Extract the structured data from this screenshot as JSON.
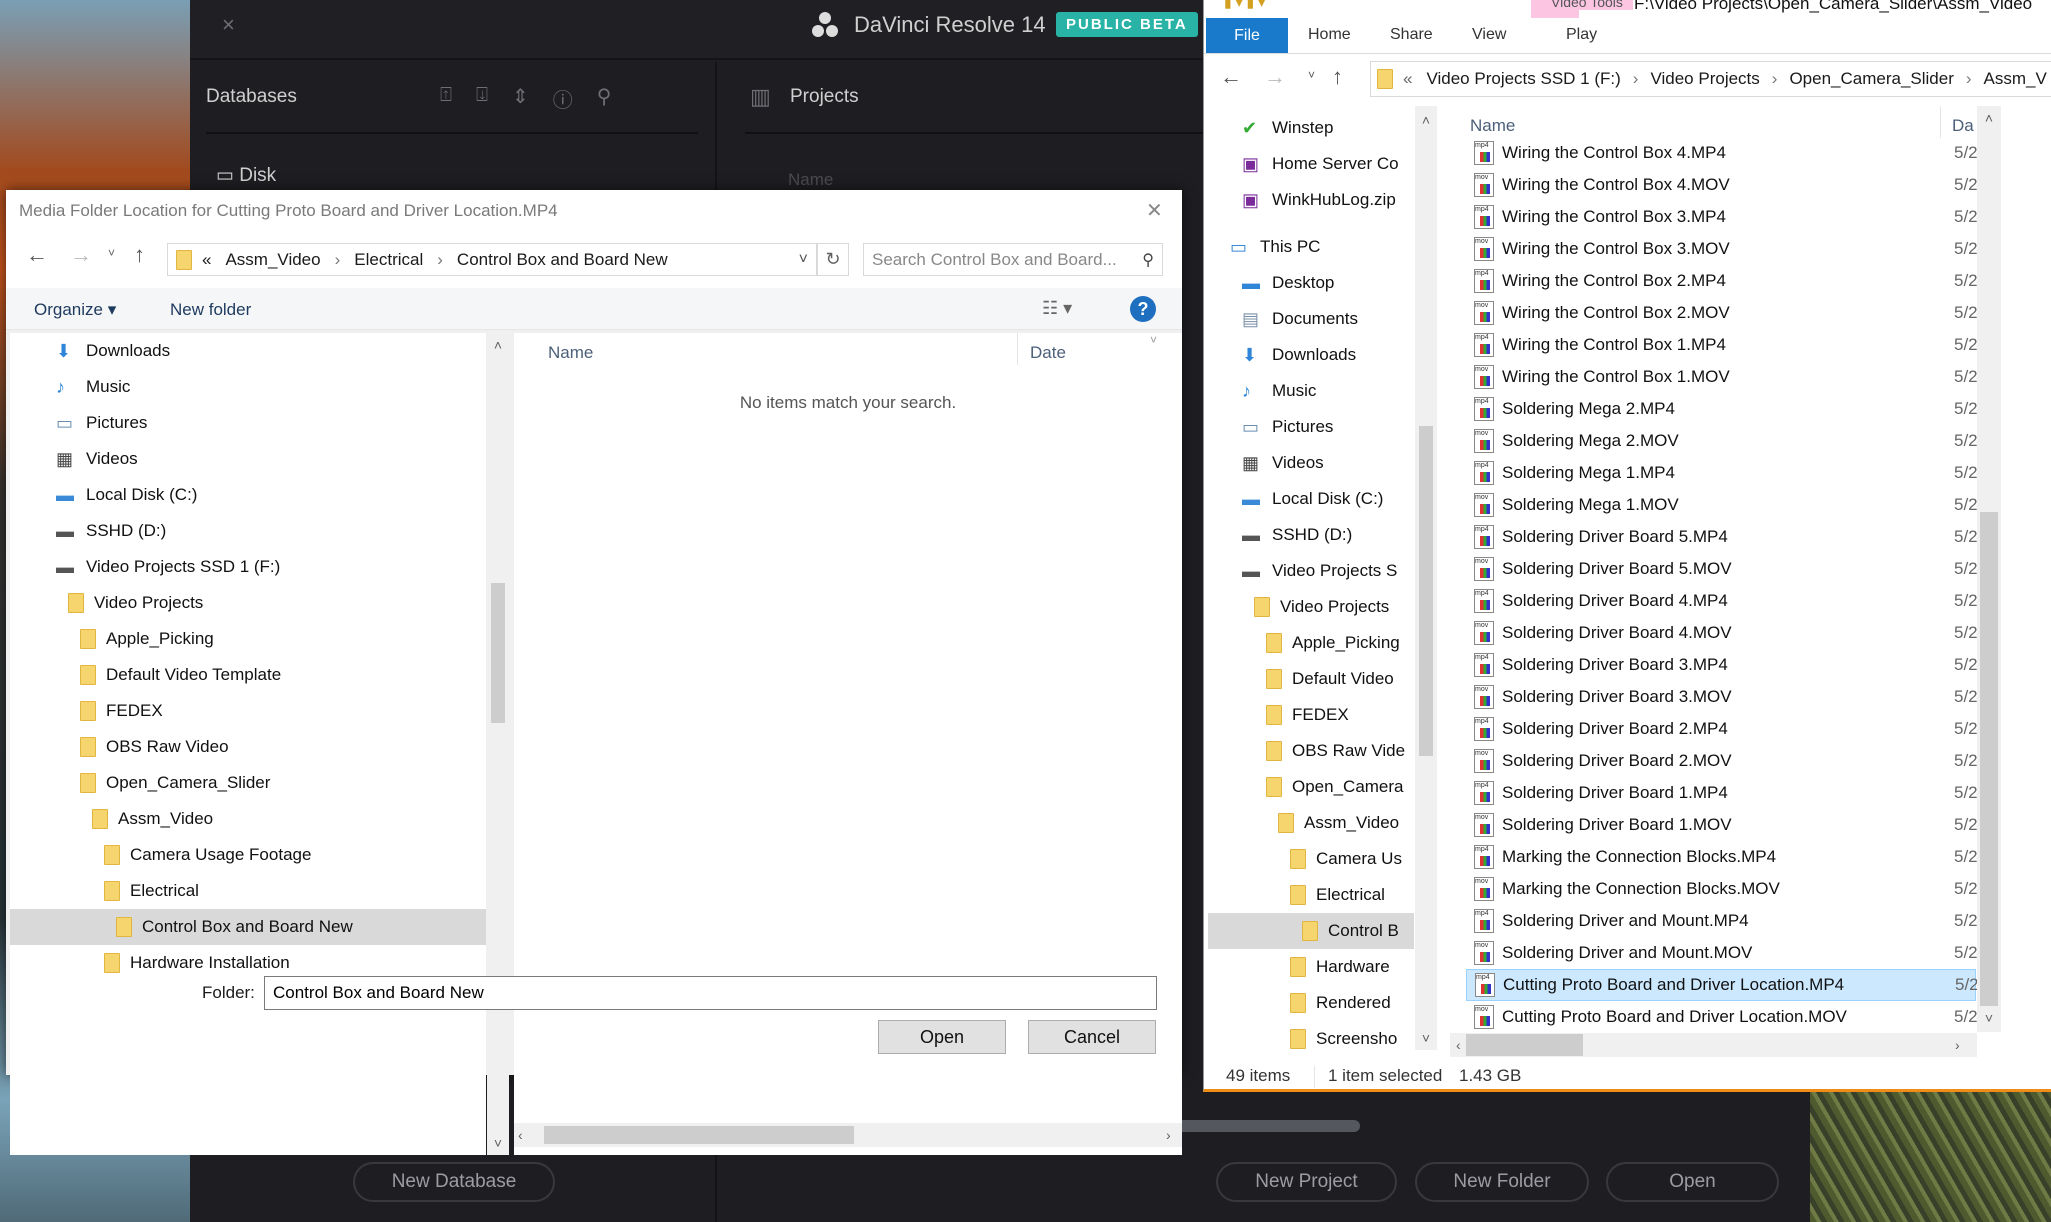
{
  "resolve": {
    "close": "×",
    "app_title": "DaVinci Resolve 14",
    "badge": "PUBLIC BETA",
    "databases_label": "Databases",
    "disk_label": "Disk",
    "projects_label": "Projects",
    "name_col": "Name",
    "new_database": "New Database",
    "new_project": "New Project",
    "new_folder": "New Folder",
    "open": "Open"
  },
  "dialog": {
    "title": "Media Folder Location for Cutting Proto Board and Driver Location.MP4",
    "close": "✕",
    "breadcrumb": [
      "«",
      "Assm_Video",
      "Electrical",
      "Control Box and Board New"
    ],
    "search_placeholder": "Search Control Box and Board...",
    "organize": "Organize ▾",
    "new_folder": "New folder",
    "col_name": "Name",
    "col_date": "Date",
    "empty_message": "No items match your search.",
    "folder_label": "Folder:",
    "folder_value": "Control Box and Board New",
    "open": "Open",
    "cancel": "Cancel",
    "nav": [
      {
        "label": "Downloads",
        "level": 0,
        "icon": "download"
      },
      {
        "label": "Music",
        "level": 0,
        "icon": "music"
      },
      {
        "label": "Pictures",
        "level": 0,
        "icon": "pictures"
      },
      {
        "label": "Videos",
        "level": 0,
        "icon": "videos"
      },
      {
        "label": "Local Disk (C:)",
        "level": 0,
        "icon": "disk"
      },
      {
        "label": "SSHD (D:)",
        "level": 0,
        "icon": "drive"
      },
      {
        "label": "Video Projects SSD 1 (F:)",
        "level": 0,
        "icon": "drive"
      },
      {
        "label": "Video Projects",
        "level": 1,
        "icon": "folder"
      },
      {
        "label": "Apple_Picking",
        "level": 2,
        "icon": "folder"
      },
      {
        "label": "Default Video Template",
        "level": 2,
        "icon": "folder"
      },
      {
        "label": "FEDEX",
        "level": 2,
        "icon": "folder"
      },
      {
        "label": "OBS Raw Video",
        "level": 2,
        "icon": "folder"
      },
      {
        "label": "Open_Camera_Slider",
        "level": 2,
        "icon": "folder"
      },
      {
        "label": "Assm_Video",
        "level": 3,
        "icon": "folder"
      },
      {
        "label": "Camera Usage Footage",
        "level": 4,
        "icon": "folder"
      },
      {
        "label": "Electrical",
        "level": 4,
        "icon": "folder"
      },
      {
        "label": "Control Box and Board New",
        "level": 5,
        "icon": "folder",
        "selected": true
      },
      {
        "label": "Hardware Installation",
        "level": 4,
        "icon": "folder"
      }
    ]
  },
  "explorer": {
    "title_path": "F:\\Video Projects\\Open_Camera_Slider\\Assm_Video",
    "context_tab": "Video Tools",
    "tabs": [
      "File",
      "Home",
      "Share",
      "View",
      "Play"
    ],
    "breadcrumb": [
      "«",
      "Video Projects SSD 1 (F:)",
      "Video Projects",
      "Open_Camera_Slider",
      "Assm_V"
    ],
    "col_name": "Name",
    "col_date": "Da",
    "nav": [
      {
        "label": "Winstep",
        "level": 1,
        "icon": "folder-check"
      },
      {
        "label": "Home Server Co",
        "level": 1,
        "icon": "zip"
      },
      {
        "label": "WinkHubLog.zip",
        "level": 1,
        "icon": "zip"
      },
      {
        "label": "This PC",
        "level": 0,
        "icon": "pc",
        "gap": true
      },
      {
        "label": "Desktop",
        "level": 1,
        "icon": "desktop"
      },
      {
        "label": "Documents",
        "level": 1,
        "icon": "documents"
      },
      {
        "label": "Downloads",
        "level": 1,
        "icon": "download"
      },
      {
        "label": "Music",
        "level": 1,
        "icon": "music"
      },
      {
        "label": "Pictures",
        "level": 1,
        "icon": "pictures"
      },
      {
        "label": "Videos",
        "level": 1,
        "icon": "videos"
      },
      {
        "label": "Local Disk (C:)",
        "level": 1,
        "icon": "disk"
      },
      {
        "label": "SSHD (D:)",
        "level": 1,
        "icon": "drive"
      },
      {
        "label": "Video Projects S",
        "level": 1,
        "icon": "drive"
      },
      {
        "label": "Video Projects",
        "level": 2,
        "icon": "folder"
      },
      {
        "label": "Apple_Picking",
        "level": 3,
        "icon": "folder"
      },
      {
        "label": "Default Video",
        "level": 3,
        "icon": "folder"
      },
      {
        "label": "FEDEX",
        "level": 3,
        "icon": "folder"
      },
      {
        "label": "OBS Raw Vide",
        "level": 3,
        "icon": "folder"
      },
      {
        "label": "Open_Camera",
        "level": 3,
        "icon": "folder"
      },
      {
        "label": "Assm_Video",
        "level": 4,
        "icon": "folder"
      },
      {
        "label": "Camera Us",
        "level": 5,
        "icon": "folder"
      },
      {
        "label": "Electrical",
        "level": 5,
        "icon": "folder"
      },
      {
        "label": "Control B",
        "level": 6,
        "icon": "folder",
        "selected": true
      },
      {
        "label": "Hardware",
        "level": 5,
        "icon": "folder"
      },
      {
        "label": "Rendered",
        "level": 5,
        "icon": "folder"
      },
      {
        "label": "Screensho",
        "level": 5,
        "icon": "folder"
      }
    ],
    "files": [
      {
        "name": "Wiring the Control Box 4.MP4",
        "type": "mp4",
        "date": "5/2"
      },
      {
        "name": "Wiring the Control Box 4.MOV",
        "type": "mov",
        "date": "5/2"
      },
      {
        "name": "Wiring the Control Box 3.MP4",
        "type": "mp4",
        "date": "5/2"
      },
      {
        "name": "Wiring the Control Box 3.MOV",
        "type": "mov",
        "date": "5/2"
      },
      {
        "name": "Wiring the Control Box 2.MP4",
        "type": "mp4",
        "date": "5/2"
      },
      {
        "name": "Wiring the Control Box 2.MOV",
        "type": "mov",
        "date": "5/2"
      },
      {
        "name": "Wiring the Control Box 1.MP4",
        "type": "mp4",
        "date": "5/2"
      },
      {
        "name": "Wiring the Control Box 1.MOV",
        "type": "mov",
        "date": "5/2"
      },
      {
        "name": "Soldering Mega 2.MP4",
        "type": "mp4",
        "date": "5/2"
      },
      {
        "name": "Soldering Mega 2.MOV",
        "type": "mov",
        "date": "5/2"
      },
      {
        "name": "Soldering Mega 1.MP4",
        "type": "mp4",
        "date": "5/2"
      },
      {
        "name": "Soldering Mega 1.MOV",
        "type": "mov",
        "date": "5/2"
      },
      {
        "name": "Soldering Driver Board 5.MP4",
        "type": "mp4",
        "date": "5/2"
      },
      {
        "name": "Soldering Driver Board 5.MOV",
        "type": "mov",
        "date": "5/2"
      },
      {
        "name": "Soldering Driver Board 4.MP4",
        "type": "mp4",
        "date": "5/2"
      },
      {
        "name": "Soldering Driver Board 4.MOV",
        "type": "mov",
        "date": "5/2"
      },
      {
        "name": "Soldering Driver Board 3.MP4",
        "type": "mp4",
        "date": "5/2"
      },
      {
        "name": "Soldering Driver Board 3.MOV",
        "type": "mov",
        "date": "5/2"
      },
      {
        "name": "Soldering Driver Board 2.MP4",
        "type": "mp4",
        "date": "5/2"
      },
      {
        "name": "Soldering Driver Board 2.MOV",
        "type": "mov",
        "date": "5/2"
      },
      {
        "name": "Soldering Driver Board 1.MP4",
        "type": "mp4",
        "date": "5/2"
      },
      {
        "name": "Soldering Driver Board 1.MOV",
        "type": "mov",
        "date": "5/2"
      },
      {
        "name": "Marking the Connection Blocks.MP4",
        "type": "mp4",
        "date": "5/2"
      },
      {
        "name": "Marking the Connection Blocks.MOV",
        "type": "mov",
        "date": "5/2"
      },
      {
        "name": "Soldering Driver and Mount.MP4",
        "type": "mp4",
        "date": "5/2"
      },
      {
        "name": "Soldering Driver and Mount.MOV",
        "type": "mov",
        "date": "5/2"
      },
      {
        "name": "Cutting Proto Board and Driver Location.MP4",
        "type": "mp4",
        "date": "5/2",
        "selected": true
      },
      {
        "name": "Cutting Proto Board and Driver Location.MOV",
        "type": "mov",
        "date": "5/2"
      }
    ],
    "status_items": "49 items",
    "status_selected": "1 item selected",
    "status_size": "1.43 GB"
  },
  "colors": {
    "accent": "#1979ca",
    "selection": "#cce8ff",
    "resolve_badge": "#29b3a7",
    "video_tools_tab": "#fcc6e3"
  }
}
